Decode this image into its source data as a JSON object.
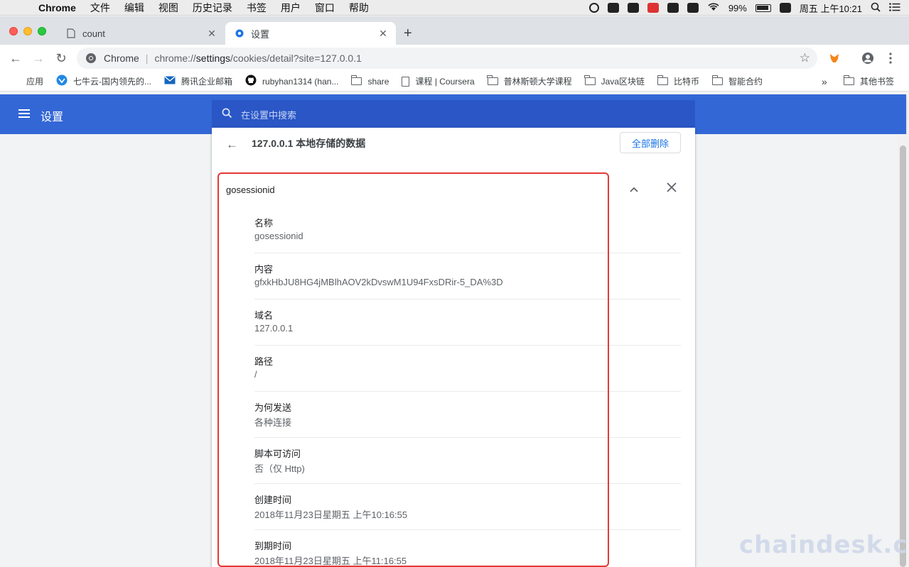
{
  "menubar": {
    "app": "Chrome",
    "items": [
      "文件",
      "编辑",
      "视图",
      "历史记录",
      "书签",
      "用户",
      "窗口",
      "帮助"
    ],
    "battery": "99%",
    "clock": "周五 上午10:21"
  },
  "tabs": [
    {
      "label": "count",
      "active": false
    },
    {
      "label": "设置",
      "active": true
    }
  ],
  "omnibox": {
    "scheme": "Chrome",
    "url_host": "chrome://",
    "url_path": "settings",
    "url_rest": "/cookies/detail?site=127.0.0.1"
  },
  "bookmarks": [
    {
      "label": "应用",
      "icon": "apps-grid-icon"
    },
    {
      "label": "七牛云-国内领先的...",
      "icon": "qiniu-icon"
    },
    {
      "label": "腾讯企业邮箱",
      "icon": "mail-icon"
    },
    {
      "label": "rubyhan1314 (han...",
      "icon": "github-icon"
    },
    {
      "label": "share",
      "icon": "folder-icon"
    },
    {
      "label": "课程 | Coursera",
      "icon": "page-icon"
    },
    {
      "label": "普林斯顿大学课程",
      "icon": "folder-icon"
    },
    {
      "label": "Java区块链",
      "icon": "folder-icon"
    },
    {
      "label": "比特币",
      "icon": "folder-icon"
    },
    {
      "label": "智能合约",
      "icon": "folder-icon"
    }
  ],
  "bookmarks_more": "»",
  "bookmarks_other": "其他书签",
  "header": {
    "title": "设置",
    "search_placeholder": "在设置中搜索"
  },
  "page": {
    "site_heading": "127.0.0.1 本地存储的数据",
    "remove_all": "全部删除",
    "cookie_name": "gosessionid"
  },
  "fields": [
    {
      "label": "名称",
      "value": "gosessionid"
    },
    {
      "label": "内容",
      "value": "gfxkHbJU8HG4jMBlhAOV2kDvswM1U94FxsDRir-5_DA%3D"
    },
    {
      "label": "域名",
      "value": "127.0.0.1"
    },
    {
      "label": "路径",
      "value": "/"
    },
    {
      "label": "为何发送",
      "value": "各种连接"
    },
    {
      "label": "脚本可访问",
      "value": "否（仅 Http)"
    },
    {
      "label": "创建时间",
      "value": "2018年11月23日星期五 上午10:16:55"
    },
    {
      "label": "到期时间",
      "value": "2018年11月23日星期五 上午11:16:55"
    }
  ],
  "watermark": "chaindesk.cn",
  "colors": {
    "header_blue": "#3367d6",
    "search_blue": "#2a56c6",
    "link_blue": "#1a73e8",
    "highlight_red": "#e53935"
  }
}
